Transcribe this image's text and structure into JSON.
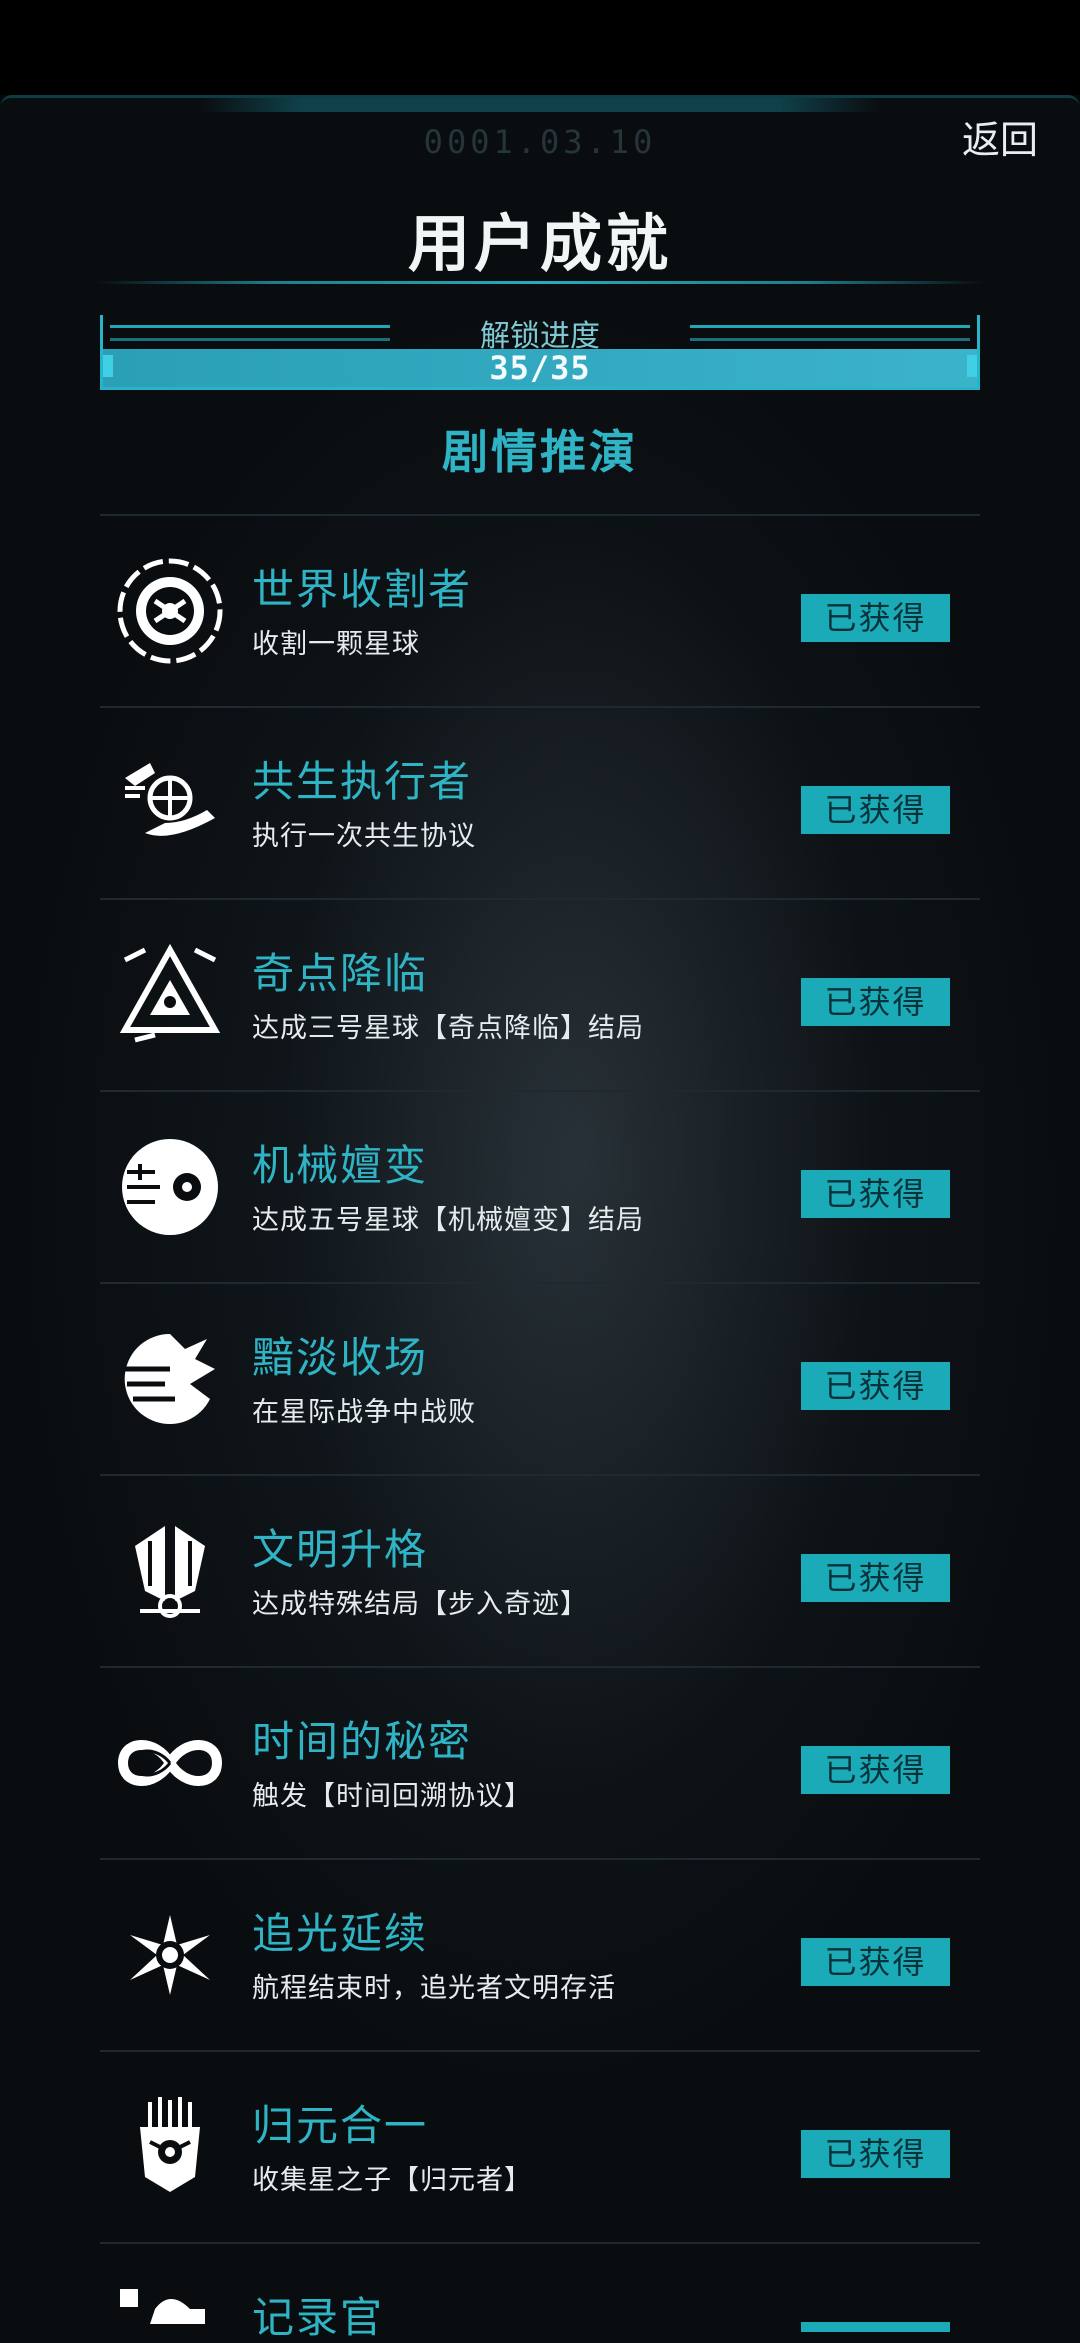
{
  "header": {
    "date": "0001.03.10",
    "back_label": "返回",
    "title": "用户成就"
  },
  "progress": {
    "label": "解锁进度",
    "text": "35/35",
    "value": 1.0
  },
  "section_title": "剧情推演",
  "achievements": [
    {
      "name": "世界收割者",
      "desc": "收割一颗星球",
      "status": "已获得",
      "icon": "planet-reaper-icon"
    },
    {
      "name": "共生执行者",
      "desc": "执行一次共生协议",
      "status": "已获得",
      "icon": "globe-hand-icon"
    },
    {
      "name": "奇点降临",
      "desc": "达成三号星球【奇点降临】结局",
      "status": "已获得",
      "icon": "singularity-triangle-icon"
    },
    {
      "name": "机械嬗变",
      "desc": "达成五号星球【机械嬗变】结局",
      "status": "已获得",
      "icon": "mech-eye-icon"
    },
    {
      "name": "黯淡收场",
      "desc": "在星际战争中战败",
      "status": "已获得",
      "icon": "shattered-planet-icon"
    },
    {
      "name": "文明升格",
      "desc": "达成特殊结局【步入奇迹】",
      "status": "已获得",
      "icon": "winged-emblem-icon"
    },
    {
      "name": "时间的秘密",
      "desc": "触发【时间回溯协议】",
      "status": "已获得",
      "icon": "infinity-icon"
    },
    {
      "name": "追光延续",
      "desc": "航程结束时，追光者文明存活",
      "status": "已获得",
      "icon": "radiant-star-icon"
    },
    {
      "name": "归元合一",
      "desc": "收集星之子【归元者】",
      "status": "已获得",
      "icon": "mask-face-icon"
    },
    {
      "name": "记录官",
      "desc": "",
      "status": "",
      "icon": "recorder-icon"
    }
  ]
}
